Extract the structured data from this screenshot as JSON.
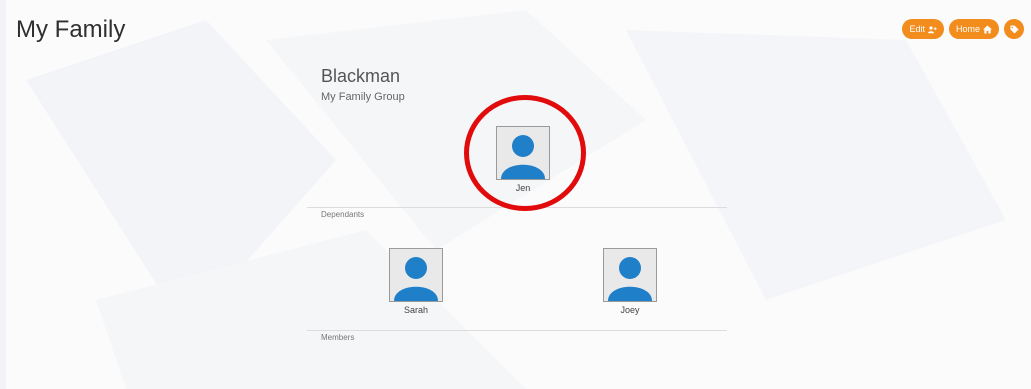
{
  "header": {
    "title": "My Family",
    "actions": [
      {
        "label": "Edit",
        "icon": "add-user-icon"
      },
      {
        "label": "Home",
        "icon": "home-icon"
      },
      {
        "label": "",
        "icon": "tag-icon"
      }
    ]
  },
  "group": {
    "name": "Blackman",
    "subtitle": "My Family Group"
  },
  "primary": {
    "name": "Jen",
    "icon": "person-avatar-icon"
  },
  "dependants": {
    "label": "Dependants",
    "people": [
      {
        "name": "Sarah",
        "icon": "person-avatar-icon"
      },
      {
        "name": "Joey",
        "icon": "person-avatar-icon"
      }
    ]
  },
  "members": {
    "label": "Members"
  },
  "colors": {
    "accent": "#f28c1c",
    "avatar": "#1f7fc9",
    "highlight": "#e10b0b"
  }
}
